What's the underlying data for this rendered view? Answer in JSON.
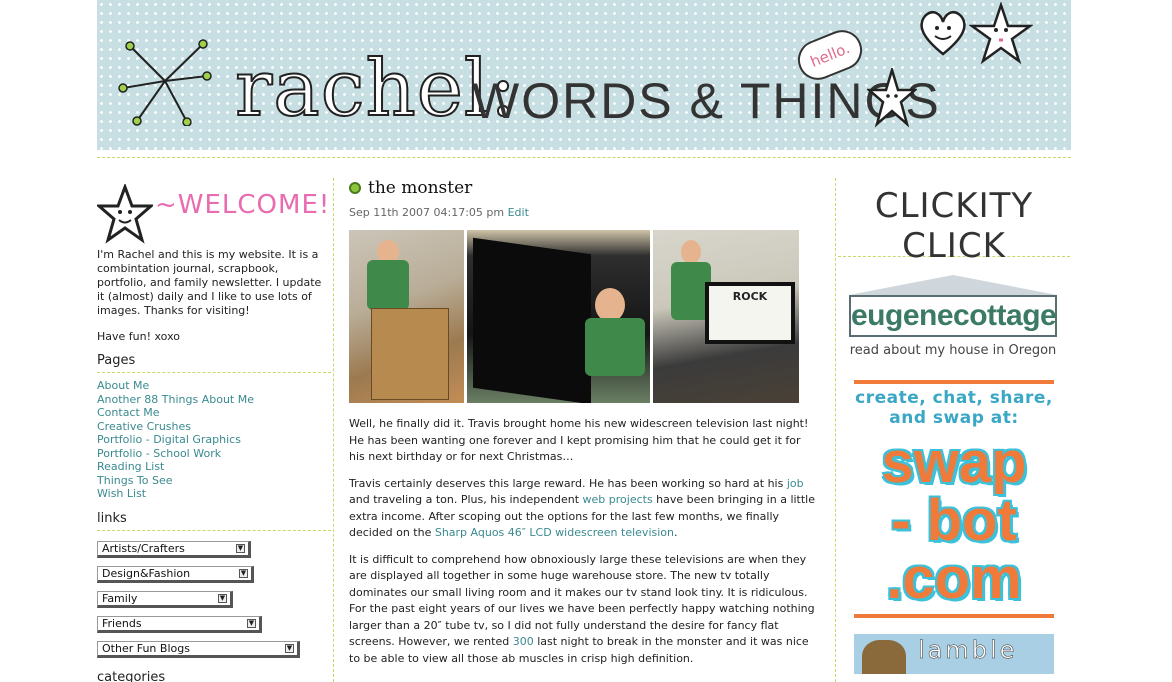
{
  "header": {
    "title": "rachel:",
    "subtitle": "WORDS & THINGS",
    "hello": "hello."
  },
  "sidebar": {
    "welcome": "~WELCOME!",
    "intro": "I'm Rachel and this is my website. It is a combintation journal, scrapbook, portfolio, and family newsletter. I update it (almost) daily and I like to use lots of images. Thanks for visiting!",
    "sign_off": "Have fun! xoxo",
    "pages_heading": "Pages",
    "pages": [
      "About Me",
      "Another 88 Things About Me",
      "Contact Me",
      "Creative Crushes",
      "Portfolio - Digital Graphics",
      "Portfolio - School Work",
      "Reading List",
      "Things To See",
      "Wish List"
    ],
    "links_heading": "links",
    "link_selects": [
      "Artists/Crafters",
      "Design&Fashion",
      "Family",
      "Friends",
      "Other Fun Blogs"
    ],
    "categories_heading": "categories"
  },
  "post": {
    "title": "the monster",
    "date": "Sep 11th 2007 04:17:05 pm",
    "edit_label": "Edit",
    "p1": "Well, he finally did it. Travis brought home his new widescreen television last night! He has been wanting one forever and I kept promising him that he could get it for his next birthday or for next Christmas…",
    "p2_a": "Travis certainly deserves this large reward. He has been working so hard at his ",
    "p2_link1": "job",
    "p2_b": " and traveling a ton. Plus, his independent ",
    "p2_link2": "web projects",
    "p2_c": " have been bringing in a little extra income. After scoping out the options for the last few months, we finally decided on the ",
    "p2_link3": "Sharp Aquos 46″ LCD widescreen television",
    "p2_d": ".",
    "p3_a": "It is difficult to comprehend how obnoxiously large these televisions are when they are displayed all together in some huge warehouse store. The new tv totally dominates our small living room and it makes our tv stand look tiny. It is ridiculous. For the past eight years of our lives we have been perfectly happy watching nothing larger than a 20″ tube tv, so I did not fully understand the desire for fancy flat screens. However, we rented ",
    "p3_link": "300",
    "p3_b": " last night to break in the monster and it was nice to be able to view all those ab muscles in crisp high definition.",
    "photo_tv_text": "ROCK"
  },
  "right": {
    "heading": "CLICKITY CLICK",
    "eugene_sign": "eugenecottage",
    "eugene_caption": "read about my house in Oregon",
    "swap_top": "create, chat, share, and swap at:",
    "swap_logo_1": "swap",
    "swap_logo_2": "- bot",
    "swap_logo_3": ".com",
    "lamble": "lamble"
  },
  "colors": {
    "banner_bg": "#c7dfe2",
    "link": "#3a8a8f",
    "welcome_pink": "#e96bb0",
    "divider": "#c8d86a",
    "swap_orange": "#f07a3a",
    "swap_blue": "#3cc1d9"
  }
}
